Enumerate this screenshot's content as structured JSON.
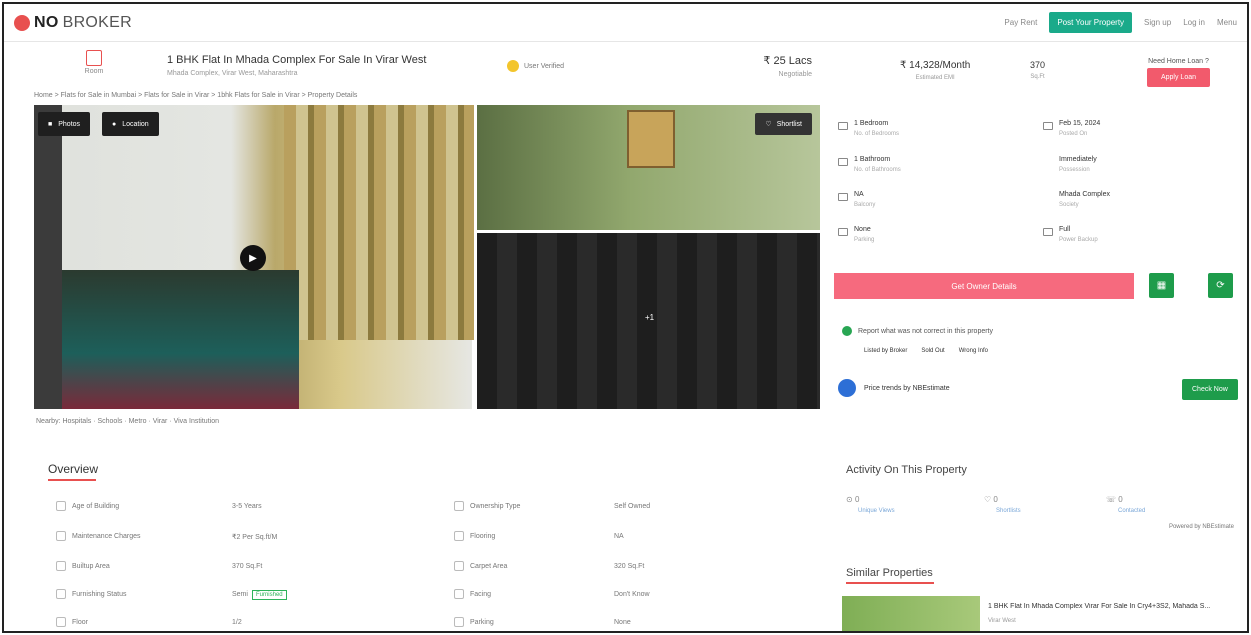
{
  "header": {
    "logo_no": "NO",
    "logo_broker": "BROKER",
    "nav_links": [
      "Pay Rent",
      "Post Your Property",
      "Sign up",
      "Log in",
      "Menu"
    ]
  },
  "property": {
    "home_label": "Room",
    "title": "1 BHK Flat In Mhada Complex For Sale In Virar West",
    "address": "Mhada Complex, Virar West, Maharashtra",
    "verified": "User Verified",
    "price": "₹ 25 Lacs",
    "negotiable": "Negotiable",
    "breadcrumb": "Home > Flats for Sale in Mumbai > Flats for Sale in Virar > 1bhk Flats for Sale in Virar > Property Details"
  },
  "gallery": {
    "photos_label": "Photos",
    "location_label": "Location",
    "shortlist_label": "Shortlist",
    "more_label": "+1"
  },
  "nearby": "Nearby: Hospitals · Schools · Metro · Virar · Viva Institution",
  "overview": {
    "title": "Overview",
    "left": [
      {
        "label": "Age of Building",
        "value": "3-5 Years"
      },
      {
        "label": "Maintenance Charges",
        "value": "₹2 Per Sq.ft/M"
      },
      {
        "label": "Builtup Area",
        "value": "370 Sq.Ft"
      },
      {
        "label": "Furnishing Status",
        "value": "Semi",
        "badge": "Furnished"
      },
      {
        "label": "Floor",
        "value": "1/2"
      }
    ],
    "right": [
      {
        "label": "Ownership Type",
        "value": "Self Owned"
      },
      {
        "label": "Flooring",
        "value": "NA"
      },
      {
        "label": "Carpet Area",
        "value": "320 Sq.Ft"
      },
      {
        "label": "Facing",
        "value": "Don't Know"
      },
      {
        "label": "Parking",
        "value": "None"
      }
    ]
  },
  "summary": {
    "emi": "₹ 14,328/Month",
    "emi_label": "Estimated EMI",
    "area": "370",
    "area_label": "Sq.Ft",
    "need_loan": "Need Home Loan ?",
    "apply_loan": "Apply Loan"
  },
  "specs": [
    {
      "value": "1 Bedroom",
      "label": "No. of Bedrooms"
    },
    {
      "value": "Feb 15, 2024",
      "label": "Posted On"
    },
    {
      "value": "1 Bathroom",
      "label": "No. of Bathrooms"
    },
    {
      "value": "Immediately",
      "label": "Possession"
    },
    {
      "value": "NA",
      "label": "Balcony"
    },
    {
      "value": "Mhada Complex",
      "label": "Society"
    },
    {
      "value": "None",
      "label": "Parking"
    },
    {
      "value": "Full",
      "label": "Power Backup"
    }
  ],
  "actions": {
    "owner_details": "Get Owner Details",
    "report": "Report what was not correct in this property",
    "report_options": [
      "Listed by Broker",
      "Sold Out",
      "Wrong Info"
    ],
    "price_trends": "Price trends by NBEstimate",
    "check_now": "Check Now"
  },
  "activity": {
    "title": "Activity On This Property",
    "items": [
      {
        "count": "0",
        "label": "Unique Views"
      },
      {
        "count": "0",
        "label": "Shortlists"
      },
      {
        "count": "0",
        "label": "Contacted"
      }
    ],
    "powered": "Powered by NBEstimate"
  },
  "similar": {
    "title": "Similar Properties",
    "item_title": "1 BHK Flat In Mhada Complex Virar For Sale In Cry4+3S2, Mahada S...",
    "item_sub": "Virar West"
  }
}
